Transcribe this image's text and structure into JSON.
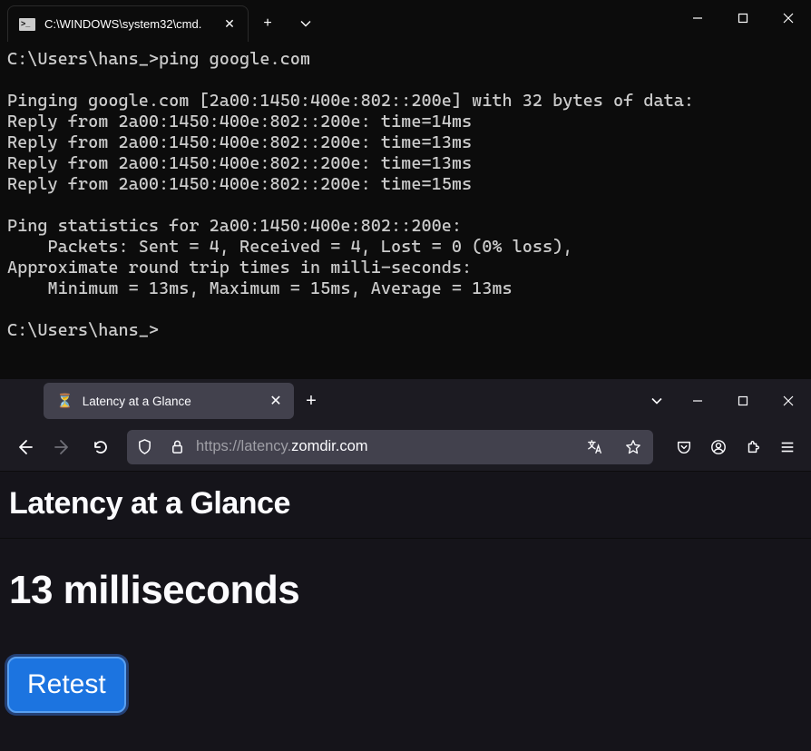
{
  "terminal": {
    "tab_title": "C:\\WINDOWS\\system32\\cmd.",
    "output": "C:\\Users\\hans_>ping google.com\n\nPinging google.com [2a00:1450:400e:802::200e] with 32 bytes of data:\nReply from 2a00:1450:400e:802::200e: time=14ms\nReply from 2a00:1450:400e:802::200e: time=13ms\nReply from 2a00:1450:400e:802::200e: time=13ms\nReply from 2a00:1450:400e:802::200e: time=15ms\n\nPing statistics for 2a00:1450:400e:802::200e:\n    Packets: Sent = 4, Received = 4, Lost = 0 (0% loss),\nApproximate round trip times in milli-seconds:\n    Minimum = 13ms, Maximum = 15ms, Average = 13ms\n\nC:\\Users\\hans_>"
  },
  "browser": {
    "tab_title": "Latency at a Glance",
    "url_prefix": "https://latency.",
    "url_domain": "zomdir.com",
    "page": {
      "heading": "Latency at a Glance",
      "result": "13 milliseconds",
      "retest_label": "Retest"
    }
  }
}
